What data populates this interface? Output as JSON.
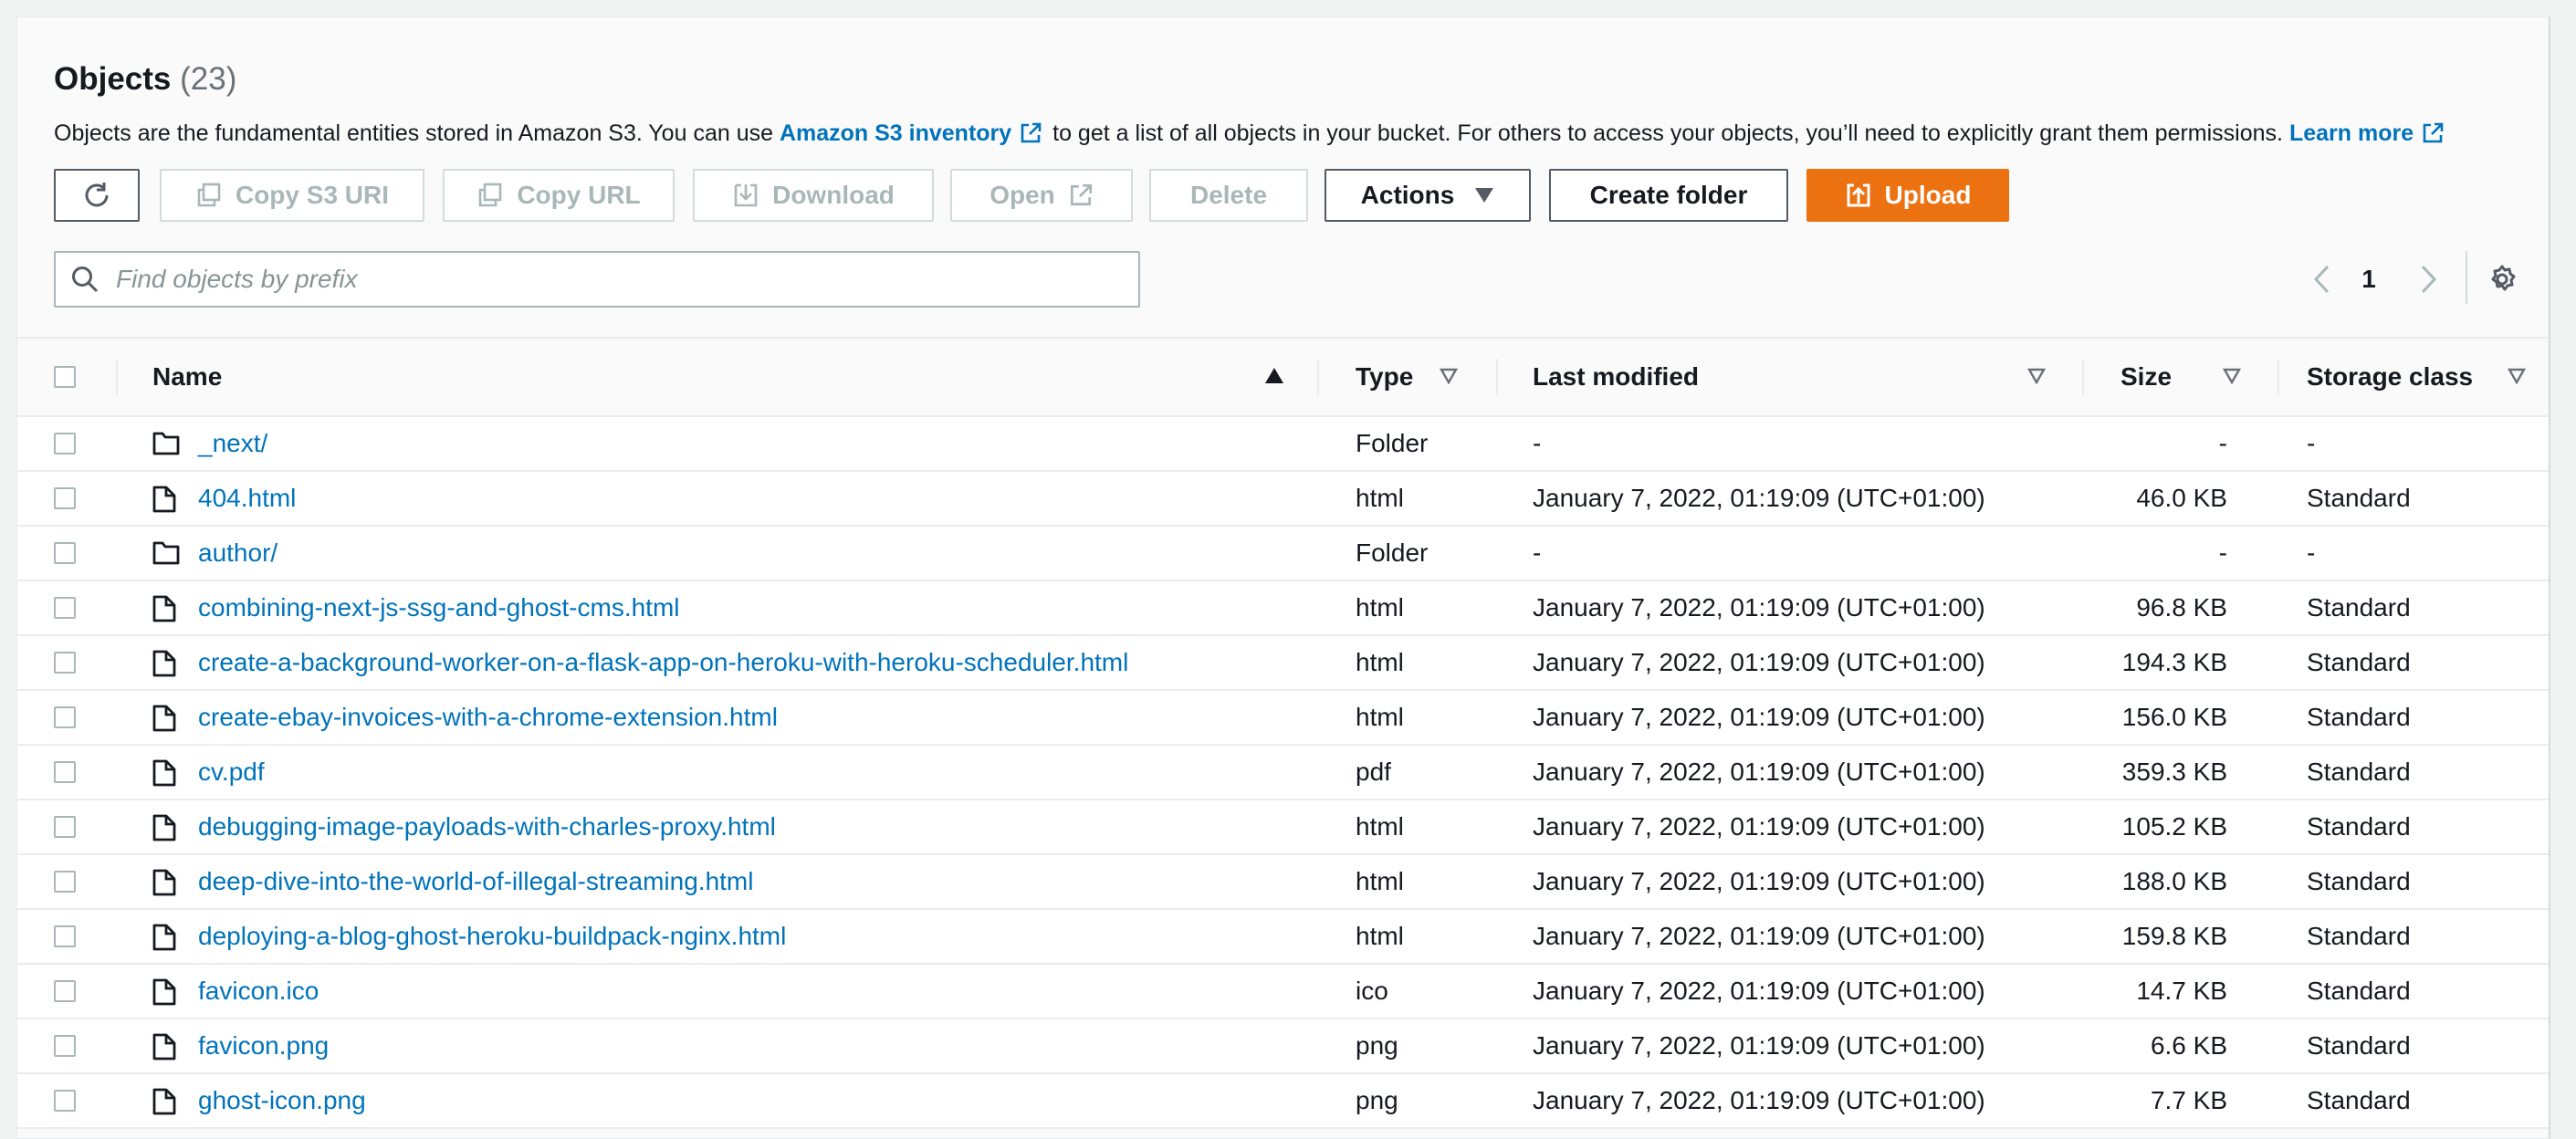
{
  "header": {
    "title": "Objects",
    "count": "(23)"
  },
  "description": {
    "text_before": "Objects are the fundamental entities stored in Amazon S3. You can use ",
    "inventory_link": "Amazon S3 inventory",
    "text_middle": " to get a list of all objects in your bucket. For others to access your objects, you’ll need to explicitly grant them permissions. ",
    "learn_more": "Learn more"
  },
  "toolbar": {
    "copy_s3_uri": "Copy S3 URI",
    "copy_url": "Copy URL",
    "download": "Download",
    "open": "Open",
    "delete": "Delete",
    "actions": "Actions",
    "create_folder": "Create folder",
    "upload": "Upload"
  },
  "search": {
    "placeholder": "Find objects by prefix"
  },
  "pagination": {
    "current_page": "1"
  },
  "colors": {
    "accent": "#ec7211",
    "link": "#0073bb",
    "text": "#16191f",
    "disabled": "#aab7b8"
  },
  "columns": {
    "name": "Name",
    "type": "Type",
    "last_modified": "Last modified",
    "size": "Size",
    "storage_class": "Storage class"
  },
  "rows": [
    {
      "icon": "folder-icon",
      "name": "_next/",
      "type": "Folder",
      "last_modified": "-",
      "size": "-",
      "storage_class": "-"
    },
    {
      "icon": "file-icon",
      "name": "404.html",
      "type": "html",
      "last_modified": "January 7, 2022, 01:19:09 (UTC+01:00)",
      "size": "46.0 KB",
      "storage_class": "Standard"
    },
    {
      "icon": "folder-icon",
      "name": "author/",
      "type": "Folder",
      "last_modified": "-",
      "size": "-",
      "storage_class": "-"
    },
    {
      "icon": "file-icon",
      "name": "combining-next-js-ssg-and-ghost-cms.html",
      "type": "html",
      "last_modified": "January 7, 2022, 01:19:09 (UTC+01:00)",
      "size": "96.8 KB",
      "storage_class": "Standard"
    },
    {
      "icon": "file-icon",
      "name": "create-a-background-worker-on-a-flask-app-on-heroku-with-heroku-scheduler.html",
      "type": "html",
      "last_modified": "January 7, 2022, 01:19:09 (UTC+01:00)",
      "size": "194.3 KB",
      "storage_class": "Standard"
    },
    {
      "icon": "file-icon",
      "name": "create-ebay-invoices-with-a-chrome-extension.html",
      "type": "html",
      "last_modified": "January 7, 2022, 01:19:09 (UTC+01:00)",
      "size": "156.0 KB",
      "storage_class": "Standard"
    },
    {
      "icon": "file-icon",
      "name": "cv.pdf",
      "type": "pdf",
      "last_modified": "January 7, 2022, 01:19:09 (UTC+01:00)",
      "size": "359.3 KB",
      "storage_class": "Standard"
    },
    {
      "icon": "file-icon",
      "name": "debugging-image-payloads-with-charles-proxy.html",
      "type": "html",
      "last_modified": "January 7, 2022, 01:19:09 (UTC+01:00)",
      "size": "105.2 KB",
      "storage_class": "Standard"
    },
    {
      "icon": "file-icon",
      "name": "deep-dive-into-the-world-of-illegal-streaming.html",
      "type": "html",
      "last_modified": "January 7, 2022, 01:19:09 (UTC+01:00)",
      "size": "188.0 KB",
      "storage_class": "Standard"
    },
    {
      "icon": "file-icon",
      "name": "deploying-a-blog-ghost-heroku-buildpack-nginx.html",
      "type": "html",
      "last_modified": "January 7, 2022, 01:19:09 (UTC+01:00)",
      "size": "159.8 KB",
      "storage_class": "Standard"
    },
    {
      "icon": "file-icon",
      "name": "favicon.ico",
      "type": "ico",
      "last_modified": "January 7, 2022, 01:19:09 (UTC+01:00)",
      "size": "14.7 KB",
      "storage_class": "Standard"
    },
    {
      "icon": "file-icon",
      "name": "favicon.png",
      "type": "png",
      "last_modified": "January 7, 2022, 01:19:09 (UTC+01:00)",
      "size": "6.6 KB",
      "storage_class": "Standard"
    },
    {
      "icon": "file-icon",
      "name": "ghost-icon.png",
      "type": "png",
      "last_modified": "January 7, 2022, 01:19:09 (UTC+01:00)",
      "size": "7.7 KB",
      "storage_class": "Standard"
    }
  ]
}
